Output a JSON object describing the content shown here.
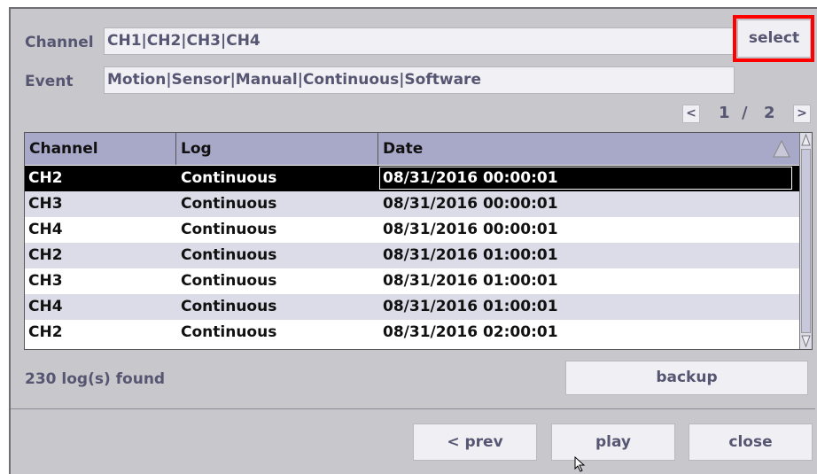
{
  "filters": {
    "channel_label": "Channel",
    "channel_value": "CH1|CH2|CH3|CH4",
    "select_label": "select",
    "event_label": "Event",
    "event_value": "Motion|Sensor|Manual|Continuous|Software"
  },
  "pagination": {
    "prev": "<",
    "current": "1",
    "sep": "/",
    "total": "2",
    "next": ">"
  },
  "table": {
    "headers": [
      "Channel",
      "Log",
      "Date"
    ],
    "rows": [
      {
        "channel": "CH2",
        "log": "Continuous",
        "date": "08/31/2016  00:00:01"
      },
      {
        "channel": "CH3",
        "log": "Continuous",
        "date": "08/31/2016  00:00:01"
      },
      {
        "channel": "CH4",
        "log": "Continuous",
        "date": "08/31/2016  00:00:01"
      },
      {
        "channel": "CH2",
        "log": "Continuous",
        "date": "08/31/2016  01:00:01"
      },
      {
        "channel": "CH3",
        "log": "Continuous",
        "date": "08/31/2016  01:00:01"
      },
      {
        "channel": "CH4",
        "log": "Continuous",
        "date": "08/31/2016  01:00:01"
      },
      {
        "channel": "CH2",
        "log": "Continuous",
        "date": "08/31/2016  02:00:01"
      }
    ]
  },
  "status": {
    "found_text": "230  log(s)  found"
  },
  "buttons": {
    "backup": "backup",
    "prev": "< prev",
    "play": "play",
    "close": "close"
  },
  "colors": {
    "header_bg": "#a8a8c8",
    "selected_bg": "#000000",
    "alt_row": "#dcdce8",
    "highlight": "#ff0000"
  }
}
